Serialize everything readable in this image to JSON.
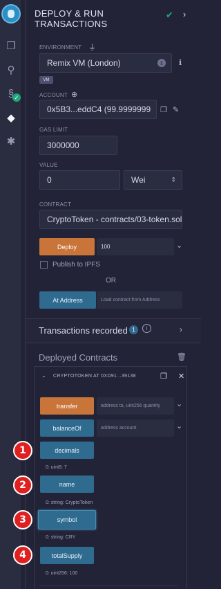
{
  "panel": {
    "title_line1": "DEPLOY & RUN",
    "title_line2": "TRANSACTIONS"
  },
  "environment": {
    "label": "ENVIRONMENT",
    "value": "Remix VM (London)",
    "badge": "VM"
  },
  "account": {
    "label": "ACCOUNT",
    "value": "0x5B3...eddC4 (99.9999999"
  },
  "gas_limit": {
    "label": "GAS LIMIT",
    "value": "3000000"
  },
  "value_field": {
    "label": "VALUE",
    "amount": "0",
    "unit": "Wei"
  },
  "contract": {
    "label": "CONTRACT",
    "value": "CryptoToken - contracts/03-token.sol"
  },
  "deploy": {
    "button": "Deploy",
    "param": "100",
    "publish_label": "Publish to IPFS",
    "or": "OR",
    "at_address_button": "At Address",
    "at_address_placeholder": "Load contract from Address"
  },
  "transactions": {
    "label": "Transactions recorded",
    "count": "1"
  },
  "deployed": {
    "label": "Deployed Contracts",
    "instance_name": "CRYPTOTOKEN AT 0XD91...39138",
    "functions": [
      {
        "name": "transfer",
        "placeholder": "address to, uint256 quantity"
      },
      {
        "name": "balanceOf",
        "placeholder": "address account"
      },
      {
        "name": "decimals",
        "result": "0: uint8: 7"
      },
      {
        "name": "name",
        "result": "0: string: CryptoToken"
      },
      {
        "name": "symbol",
        "result": "0: string: CRY"
      },
      {
        "name": "totalSupply",
        "result": "0: uint256: 100"
      }
    ]
  },
  "annotations": [
    "1",
    "2",
    "3",
    "4"
  ],
  "colors": {
    "deploy_orange": "#c97539",
    "call_blue": "#2f6a8f",
    "annotation_red": "#e02020",
    "success_green": "#1ea97c"
  }
}
